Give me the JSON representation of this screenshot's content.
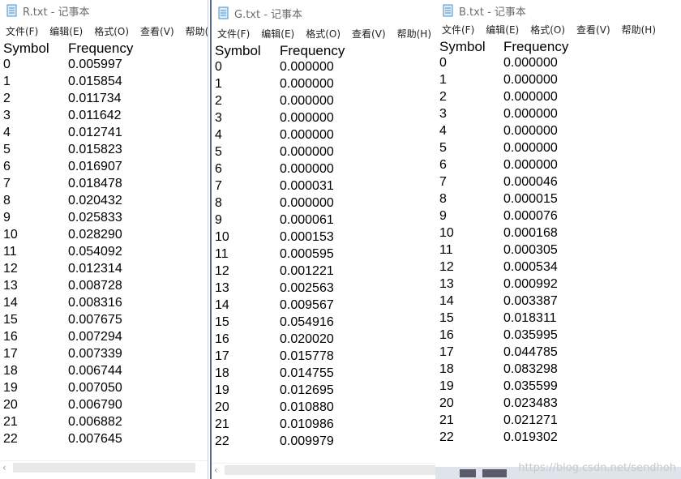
{
  "menu_labels": [
    "文件(F)",
    "编辑(E)",
    "格式(O)",
    "查看(V)",
    "帮助(H)"
  ],
  "watermark": "https://blog.csdn.net/sendhoh",
  "windows": [
    {
      "title": "R.txt - 记事本",
      "header": {
        "symbol": "Symbol",
        "frequency": "Frequency"
      },
      "rows": [
        {
          "s": "0",
          "f": "0.005997"
        },
        {
          "s": "1",
          "f": "0.015854"
        },
        {
          "s": "2",
          "f": "0.011734"
        },
        {
          "s": "3",
          "f": "0.011642"
        },
        {
          "s": "4",
          "f": "0.012741"
        },
        {
          "s": "5",
          "f": "0.015823"
        },
        {
          "s": "6",
          "f": "0.016907"
        },
        {
          "s": "7",
          "f": "0.018478"
        },
        {
          "s": "8",
          "f": "0.020432"
        },
        {
          "s": "9",
          "f": "0.025833"
        },
        {
          "s": "10",
          "f": "0.028290"
        },
        {
          "s": "11",
          "f": "0.054092"
        },
        {
          "s": "12",
          "f": "0.012314"
        },
        {
          "s": "13",
          "f": "0.008728"
        },
        {
          "s": "14",
          "f": "0.008316"
        },
        {
          "s": "15",
          "f": "0.007675"
        },
        {
          "s": "16",
          "f": "0.007294"
        },
        {
          "s": "17",
          "f": "0.007339"
        },
        {
          "s": "18",
          "f": "0.006744"
        },
        {
          "s": "19",
          "f": "0.007050"
        },
        {
          "s": "20",
          "f": "0.006790"
        },
        {
          "s": "21",
          "f": "0.006882"
        },
        {
          "s": "22",
          "f": "0.007645"
        }
      ]
    },
    {
      "title": "G.txt - 记事本",
      "header": {
        "symbol": "Symbol",
        "frequency": "Frequency"
      },
      "rows": [
        {
          "s": "0",
          "f": "0.000000"
        },
        {
          "s": "1",
          "f": "0.000000"
        },
        {
          "s": "2",
          "f": "0.000000"
        },
        {
          "s": "3",
          "f": "0.000000"
        },
        {
          "s": "4",
          "f": "0.000000"
        },
        {
          "s": "5",
          "f": "0.000000"
        },
        {
          "s": "6",
          "f": "0.000000"
        },
        {
          "s": "7",
          "f": "0.000031"
        },
        {
          "s": "8",
          "f": "0.000000"
        },
        {
          "s": "9",
          "f": "0.000061"
        },
        {
          "s": "10",
          "f": "0.000153"
        },
        {
          "s": "11",
          "f": "0.000595"
        },
        {
          "s": "12",
          "f": "0.001221"
        },
        {
          "s": "13",
          "f": "0.002563"
        },
        {
          "s": "14",
          "f": "0.009567"
        },
        {
          "s": "15",
          "f": "0.054916"
        },
        {
          "s": "16",
          "f": "0.020020"
        },
        {
          "s": "17",
          "f": "0.015778"
        },
        {
          "s": "18",
          "f": "0.014755"
        },
        {
          "s": "19",
          "f": "0.012695"
        },
        {
          "s": "20",
          "f": "0.010880"
        },
        {
          "s": "21",
          "f": "0.010986"
        },
        {
          "s": "22",
          "f": "0.009979"
        }
      ]
    },
    {
      "title": "B.txt - 记事本",
      "header": {
        "symbol": "Symbol",
        "frequency": "Frequency"
      },
      "rows": [
        {
          "s": "0",
          "f": "0.000000"
        },
        {
          "s": "1",
          "f": "0.000000"
        },
        {
          "s": "2",
          "f": "0.000000"
        },
        {
          "s": "3",
          "f": "0.000000"
        },
        {
          "s": "4",
          "f": "0.000000"
        },
        {
          "s": "5",
          "f": "0.000000"
        },
        {
          "s": "6",
          "f": "0.000000"
        },
        {
          "s": "7",
          "f": "0.000046"
        },
        {
          "s": "8",
          "f": "0.000015"
        },
        {
          "s": "9",
          "f": "0.000076"
        },
        {
          "s": "10",
          "f": "0.000168"
        },
        {
          "s": "11",
          "f": "0.000305"
        },
        {
          "s": "12",
          "f": "0.000534"
        },
        {
          "s": "13",
          "f": "0.000992"
        },
        {
          "s": "14",
          "f": "0.003387"
        },
        {
          "s": "15",
          "f": "0.018311"
        },
        {
          "s": "16",
          "f": "0.035995"
        },
        {
          "s": "17",
          "f": "0.044785"
        },
        {
          "s": "18",
          "f": "0.083298"
        },
        {
          "s": "19",
          "f": "0.035599"
        },
        {
          "s": "20",
          "f": "0.023483"
        },
        {
          "s": "21",
          "f": "0.021271"
        },
        {
          "s": "22",
          "f": "0.019302"
        }
      ]
    }
  ]
}
